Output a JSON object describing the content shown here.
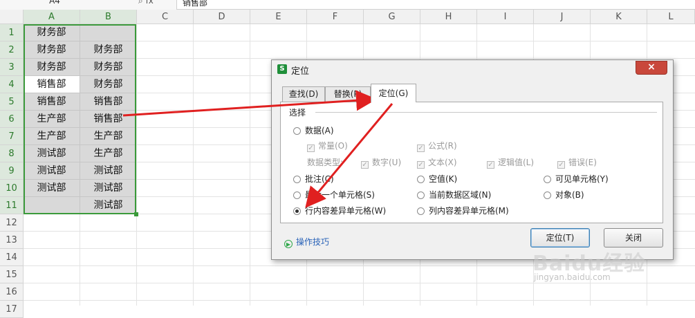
{
  "formula_bar": {
    "name_box": "A4",
    "fx_label": "fx",
    "content": "销售部"
  },
  "sheet": {
    "columns": [
      "A",
      "B",
      "C",
      "D",
      "E",
      "F",
      "G",
      "H",
      "I",
      "J",
      "K",
      "L"
    ],
    "rows": [
      "1",
      "2",
      "3",
      "4",
      "5",
      "6",
      "7",
      "8",
      "9",
      "10",
      "11",
      "12",
      "13",
      "14",
      "15",
      "16",
      "17"
    ],
    "cells": [
      [
        "财务部",
        ""
      ],
      [
        "财务部",
        "财务部"
      ],
      [
        "财务部",
        "财务部"
      ],
      [
        "销售部",
        "财务部"
      ],
      [
        "销售部",
        "销售部"
      ],
      [
        "生产部",
        "销售部"
      ],
      [
        "生产部",
        "生产部"
      ],
      [
        "测试部",
        "生产部"
      ],
      [
        "测试部",
        "测试部"
      ],
      [
        "测试部",
        "测试部"
      ],
      [
        "",
        "测试部"
      ]
    ]
  },
  "dialog": {
    "logo": "S",
    "title": "定位",
    "close": "×",
    "tabs": [
      "查找(D)",
      "替换(P)",
      "定位(G)"
    ],
    "group_label": "选择",
    "options": {
      "data": "数据(A)",
      "constant": "常量(O)",
      "formula": "公式(R)",
      "data_type_label": "数据类型:",
      "number": "数字(U)",
      "text": "文本(X)",
      "logical": "逻辑值(L)",
      "error": "错误(E)",
      "comment": "批注(C)",
      "blank": "空值(K)",
      "visible": "可见单元格(Y)",
      "last_cell": "最后一个单元格(S)",
      "current_region": "当前数据区域(N)",
      "objects": "对象(B)",
      "row_diff": "行内容差异单元格(W)",
      "col_diff": "列内容差异单元格(M)"
    },
    "tips": "操作技巧",
    "locate_button": "定位(T)",
    "close_button": "关闭"
  },
  "watermark": {
    "brand": "Baidu经验",
    "url": "jingyan.baidu.com"
  },
  "colors": {
    "selection_border": "#3a9a3a",
    "close_red": "#c9483b",
    "arrow_red": "#e02020"
  }
}
